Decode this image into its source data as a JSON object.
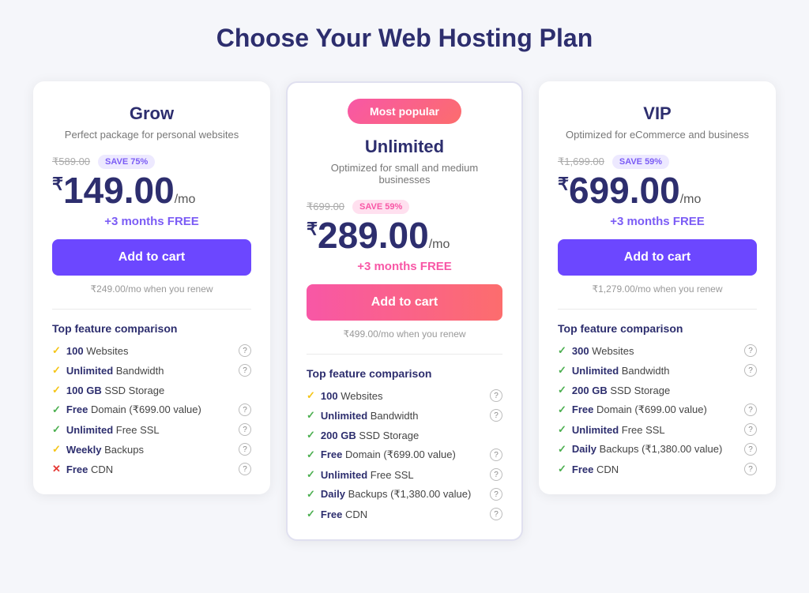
{
  "page": {
    "title": "Choose Your Web Hosting Plan"
  },
  "plans": [
    {
      "id": "grow",
      "name": "Grow",
      "desc": "Perfect package for personal websites",
      "popular": false,
      "original_price": "₹589.00",
      "save_badge": "SAVE 75%",
      "save_badge_style": "purple",
      "price_symbol": "₹",
      "price": "149.00",
      "period": "/mo",
      "free_months": "+3 months FREE",
      "free_months_style": "purple",
      "cart_btn_label": "Add to cart",
      "cart_btn_style": "purple",
      "renew": "₹249.00/mo when you renew",
      "features_title": "Top feature comparison",
      "features": [
        {
          "check": "yellow",
          "bold": "100",
          "text": " Websites",
          "help": true
        },
        {
          "check": "yellow",
          "bold": "Unlimited",
          "text": " Bandwidth",
          "help": true
        },
        {
          "check": "yellow",
          "bold": "100 GB",
          "text": " SSD Storage",
          "help": false
        },
        {
          "check": "green",
          "bold": "Free",
          "text": " Domain (₹699.00 value)",
          "help": true
        },
        {
          "check": "green",
          "bold": "Unlimited",
          "text": " Free SSL",
          "help": true
        },
        {
          "check": "yellow",
          "bold": "Weekly",
          "text": " Backups",
          "help": true
        },
        {
          "check": "red",
          "bold": "Free",
          "text": " CDN",
          "help": true
        }
      ]
    },
    {
      "id": "unlimited",
      "name": "Unlimited",
      "desc": "Optimized for small and medium businesses",
      "popular": true,
      "popular_label": "Most popular",
      "original_price": "₹699.00",
      "save_badge": "SAVE 59%",
      "save_badge_style": "pink",
      "price_symbol": "₹",
      "price": "289.00",
      "period": "/mo",
      "free_months": "+3 months FREE",
      "free_months_style": "pink",
      "cart_btn_label": "Add to cart",
      "cart_btn_style": "pink",
      "renew": "₹499.00/mo when you renew",
      "features_title": "Top feature comparison",
      "features": [
        {
          "check": "yellow",
          "bold": "100",
          "text": " Websites",
          "help": true
        },
        {
          "check": "green",
          "bold": "Unlimited",
          "text": " Bandwidth",
          "help": true
        },
        {
          "check": "green",
          "bold": "200 GB",
          "text": " SSD Storage",
          "help": false
        },
        {
          "check": "green",
          "bold": "Free",
          "text": " Domain (₹699.00 value)",
          "help": true
        },
        {
          "check": "green",
          "bold": "Unlimited",
          "text": " Free SSL",
          "help": true
        },
        {
          "check": "green",
          "bold": "Daily",
          "text": " Backups (₹1,380.00 value)",
          "help": true
        },
        {
          "check": "green",
          "bold": "Free",
          "text": " CDN",
          "help": true
        }
      ]
    },
    {
      "id": "vip",
      "name": "VIP",
      "desc": "Optimized for eCommerce and business",
      "popular": false,
      "original_price": "₹1,699.00",
      "save_badge": "SAVE 59%",
      "save_badge_style": "purple",
      "price_symbol": "₹",
      "price": "699.00",
      "period": "/mo",
      "free_months": "+3 months FREE",
      "free_months_style": "purple",
      "cart_btn_label": "Add to cart",
      "cart_btn_style": "purple",
      "renew": "₹1,279.00/mo when you renew",
      "features_title": "Top feature comparison",
      "features": [
        {
          "check": "green",
          "bold": "300",
          "text": " Websites",
          "help": true
        },
        {
          "check": "green",
          "bold": "Unlimited",
          "text": " Bandwidth",
          "help": true
        },
        {
          "check": "green",
          "bold": "200 GB",
          "text": " SSD Storage",
          "help": false
        },
        {
          "check": "green",
          "bold": "Free",
          "text": " Domain (₹699.00 value)",
          "help": true
        },
        {
          "check": "green",
          "bold": "Unlimited",
          "text": " Free SSL",
          "help": true
        },
        {
          "check": "green",
          "bold": "Daily",
          "text": " Backups (₹1,380.00 value)",
          "help": true
        },
        {
          "check": "green",
          "bold": "Free",
          "text": " CDN",
          "help": true
        }
      ]
    }
  ]
}
